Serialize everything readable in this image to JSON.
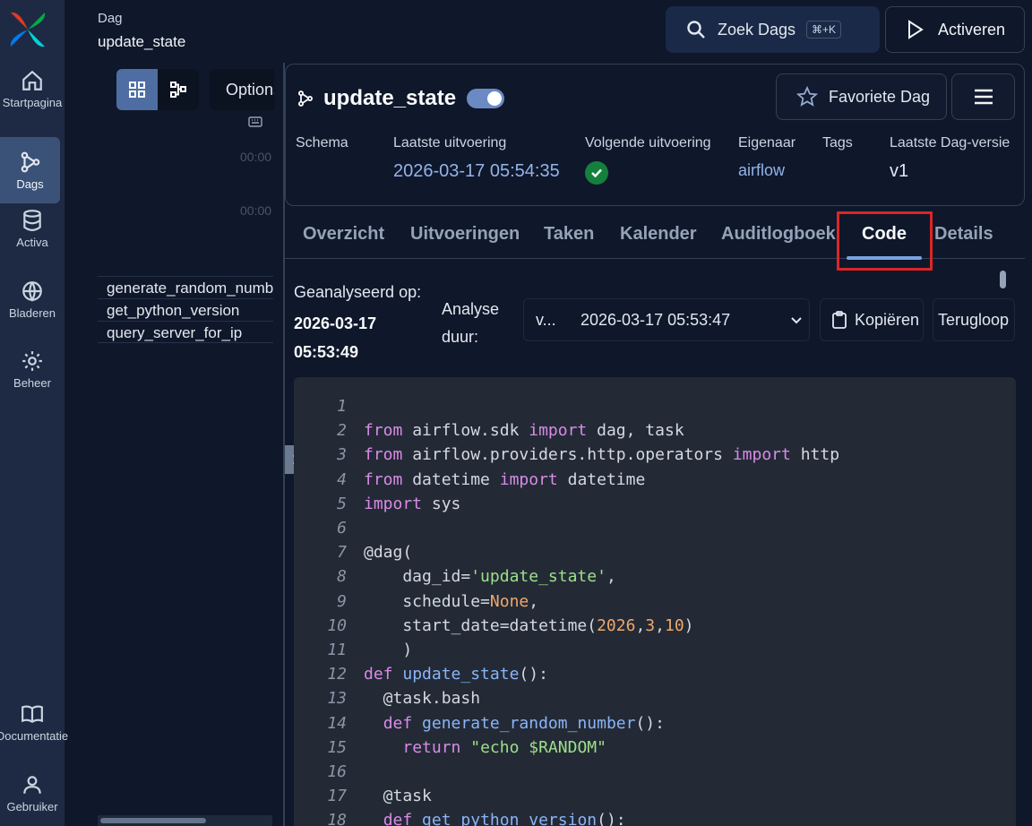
{
  "nav": {
    "items": [
      {
        "label": "Startpagina",
        "icon": "home-icon"
      },
      {
        "label": "Dags",
        "icon": "dags-icon"
      },
      {
        "label": "Activa",
        "icon": "database-icon"
      },
      {
        "label": "Bladeren",
        "icon": "globe-icon"
      },
      {
        "label": "Beheer",
        "icon": "gear-icon"
      },
      {
        "label": "Documentatie",
        "icon": "book-icon"
      },
      {
        "label": "Gebruiker",
        "icon": "user-icon"
      }
    ]
  },
  "header": {
    "crumb_label": "Dag",
    "crumb_name": "update_state",
    "search_label": "Zoek Dags",
    "search_shortcut": "⌘+K",
    "activate_label": "Activeren"
  },
  "left_panel": {
    "options_label": "Options",
    "time_labels": [
      "00:00",
      "00:00"
    ],
    "tasks": [
      "generate_random_number",
      "get_python_version",
      "query_server_for_ip"
    ]
  },
  "dag": {
    "name": "update_state",
    "favorite_label": "Favoriete Dag",
    "meta": {
      "schedule_label": "Schema",
      "last_run_label": "Laatste uitvoering",
      "last_run_value": "2026-03-17 05:54:35",
      "next_run_label": "Volgende uitvoering",
      "owner_label": "Eigenaar",
      "owner_value": "airflow",
      "tags_label": "Tags",
      "version_label": "Laatste Dag-versie",
      "version_value": "v1"
    }
  },
  "tabs": [
    "Overzicht",
    "Uitvoeringen",
    "Taken",
    "Kalender",
    "Auditlogboek",
    "Code",
    "Details"
  ],
  "active_tab": "Code",
  "code_toolbar": {
    "parsed_label": "Geanalyseerd op:",
    "parsed_date": "2026-03-17",
    "parsed_time": "05:53:49",
    "analysis_label_1": "Analyse",
    "analysis_label_2": "duur:",
    "version_short": "v...",
    "version_date": "2026-03-17 05:53:47",
    "copy_label": "Kopiëren",
    "wrap_label": "Terugloop"
  },
  "colors": {
    "accent": "#7aa2e3",
    "highlight": "#dc2626",
    "success": "#15803d"
  },
  "code_lines": [
    {
      "n": "1",
      "tokens": []
    },
    {
      "n": "2",
      "tokens": [
        [
          "keyword",
          "from"
        ],
        [
          "plain",
          " airflow.sdk "
        ],
        [
          "keyword",
          "import"
        ],
        [
          "plain",
          " dag, task"
        ]
      ]
    },
    {
      "n": "3",
      "tokens": [
        [
          "keyword",
          "from"
        ],
        [
          "plain",
          " airflow.providers.http.operators "
        ],
        [
          "keyword",
          "import"
        ],
        [
          "plain",
          " http"
        ]
      ]
    },
    {
      "n": "4",
      "tokens": [
        [
          "keyword",
          "from"
        ],
        [
          "plain",
          " datetime "
        ],
        [
          "keyword",
          "import"
        ],
        [
          "plain",
          " datetime"
        ]
      ]
    },
    {
      "n": "5",
      "tokens": [
        [
          "keyword",
          "import"
        ],
        [
          "plain",
          " sys"
        ]
      ]
    },
    {
      "n": "6",
      "tokens": []
    },
    {
      "n": "7",
      "tokens": [
        [
          "plain",
          "@dag("
        ]
      ]
    },
    {
      "n": "8",
      "tokens": [
        [
          "plain",
          "    dag_id="
        ],
        [
          "string",
          "'update_state'"
        ],
        [
          "plain",
          ","
        ]
      ]
    },
    {
      "n": "9",
      "tokens": [
        [
          "plain",
          "    schedule="
        ],
        [
          "builtin",
          "None"
        ],
        [
          "plain",
          ","
        ]
      ]
    },
    {
      "n": "10",
      "tokens": [
        [
          "plain",
          "    start_date=datetime("
        ],
        [
          "number",
          "2026"
        ],
        [
          "plain",
          ","
        ],
        [
          "number",
          "3"
        ],
        [
          "plain",
          ","
        ],
        [
          "number",
          "10"
        ],
        [
          "plain",
          ")"
        ]
      ]
    },
    {
      "n": "11",
      "tokens": [
        [
          "plain",
          "    )"
        ]
      ]
    },
    {
      "n": "12",
      "tokens": [
        [
          "keyword",
          "def"
        ],
        [
          "plain",
          " "
        ],
        [
          "func",
          "update_state"
        ],
        [
          "plain",
          "():"
        ]
      ]
    },
    {
      "n": "13",
      "tokens": [
        [
          "plain",
          "  @task.bash"
        ]
      ]
    },
    {
      "n": "14",
      "tokens": [
        [
          "plain",
          "  "
        ],
        [
          "keyword",
          "def"
        ],
        [
          "plain",
          " "
        ],
        [
          "func",
          "generate_random_number"
        ],
        [
          "plain",
          "():"
        ]
      ]
    },
    {
      "n": "15",
      "tokens": [
        [
          "plain",
          "    "
        ],
        [
          "keyword",
          "return"
        ],
        [
          "plain",
          " "
        ],
        [
          "string",
          "\"echo $RANDOM\""
        ]
      ]
    },
    {
      "n": "16",
      "tokens": []
    },
    {
      "n": "17",
      "tokens": [
        [
          "plain",
          "  @task"
        ]
      ]
    },
    {
      "n": "18",
      "tokens": [
        [
          "plain",
          "  "
        ],
        [
          "keyword",
          "def"
        ],
        [
          "plain",
          " "
        ],
        [
          "func",
          "get_python_version"
        ],
        [
          "plain",
          "():"
        ]
      ]
    }
  ]
}
